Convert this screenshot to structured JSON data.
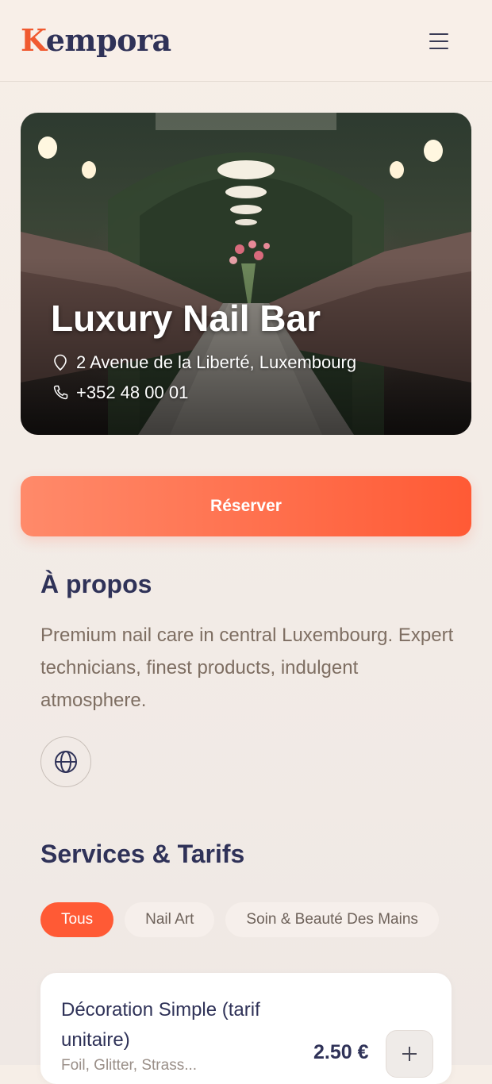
{
  "header": {
    "logo_first": "K",
    "logo_rest": "empora",
    "menu_icon": "hamburger-menu-icon"
  },
  "salon": {
    "name": "Luxury Nail Bar",
    "address": "2 Avenue de la Liberté, Luxembourg",
    "phone": "+352 48 00 01",
    "address_icon": "location-pin-icon",
    "phone_icon": "phone-icon"
  },
  "reserve": {
    "label": "Réserver"
  },
  "about": {
    "title": "À propos",
    "description": "Premium nail care in central Luxembourg. Expert technicians, finest products, indulgent atmosphere.",
    "website_icon": "globe-icon"
  },
  "services": {
    "title": "Services & Tarifs",
    "filters": [
      {
        "label": "Tous",
        "active": true
      },
      {
        "label": "Nail Art",
        "active": false
      },
      {
        "label": "Soin & Beauté Des Mains",
        "active": false
      }
    ],
    "items": [
      {
        "name": "Décoration Simple (tarif unitaire)",
        "subtitle": "Foil, Glitter, Strass...",
        "price": "2.50 €",
        "add_icon": "plus-icon"
      }
    ]
  },
  "colors": {
    "accent": "#ff5a35",
    "navy": "#2f3258",
    "muted_text": "#7e6e62",
    "background": "#f4ece6"
  }
}
